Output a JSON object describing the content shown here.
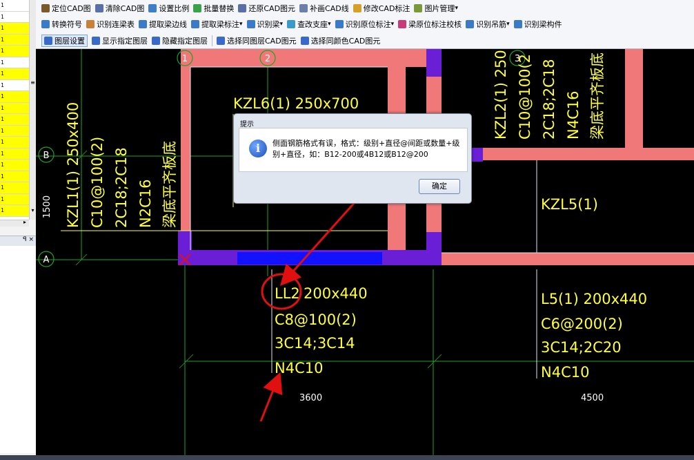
{
  "left_panel": {
    "rows": [
      {
        "text": "1",
        "highlight": false
      },
      {
        "text": "1",
        "highlight": false
      },
      {
        "text": "1",
        "highlight": true
      },
      {
        "text": "1",
        "highlight": true
      },
      {
        "text": "1",
        "highlight": true
      },
      {
        "text": "1",
        "highlight": false
      },
      {
        "text": "1",
        "highlight": true
      },
      {
        "text": "1",
        "highlight": false
      },
      {
        "text": "1",
        "highlight": true
      },
      {
        "text": "1",
        "highlight": true
      },
      {
        "text": "1",
        "highlight": true
      },
      {
        "text": "1",
        "highlight": true
      },
      {
        "text": "1",
        "highlight": true
      },
      {
        "text": "1",
        "highlight": true
      },
      {
        "text": "1",
        "highlight": true
      },
      {
        "text": "1",
        "highlight": true
      },
      {
        "text": "1",
        "highlight": true
      },
      {
        "text": "1",
        "highlight": true
      },
      {
        "text": "1",
        "highlight": true
      }
    ],
    "scroll_marker": "≡",
    "pane_controls": "ꟼ ×"
  },
  "toolbar": {
    "row1": [
      {
        "label": "定位CAD图",
        "icon": "locate-cad-icon",
        "color": "#7a5a2a"
      },
      {
        "label": "清除CAD图",
        "icon": "clear-cad-icon",
        "color": "#5a6ea8"
      },
      {
        "label": "设置比例",
        "icon": "set-scale-icon",
        "color": "#3f7fc9"
      },
      {
        "label": "批量替换",
        "icon": "batch-replace-icon",
        "color": "#3aa24a"
      },
      {
        "label": "还原CAD图元",
        "icon": "restore-cad-icon",
        "color": "#5a6ea8"
      },
      {
        "label": "补画CAD线",
        "icon": "draw-cad-line-icon",
        "color": "#6b7fa8"
      },
      {
        "label": "修改CAD标注",
        "icon": "edit-cad-label-icon",
        "color": "#d6a028"
      },
      {
        "label": "图片管理",
        "icon": "image-manage-icon",
        "color": "#7a9a3a",
        "dropdown": true
      }
    ],
    "row2": [
      {
        "label": "转换符号",
        "icon": "convert-symbol-icon",
        "color": "#3a7ac9"
      },
      {
        "label": "识别连梁表",
        "icon": "recognize-beam-table-icon",
        "color": "#c9813a"
      },
      {
        "label": "提取梁边线",
        "icon": "extract-beam-edge-icon",
        "color": "#3a7ac9"
      },
      {
        "label": "提取梁标注",
        "icon": "extract-beam-label-icon",
        "color": "#3a7ac9",
        "dropdown": true
      },
      {
        "label": "识别梁",
        "icon": "recognize-beam-icon",
        "color": "#3a7ac9",
        "dropdown": true
      },
      {
        "label": "查改支座",
        "icon": "check-support-icon",
        "color": "#3a9ac9",
        "dropdown": true
      },
      {
        "label": "识别原位标注",
        "icon": "recognize-inplace-label-icon",
        "color": "#3a7ac9",
        "dropdown": true
      },
      {
        "label": "梁原位标注校核",
        "icon": "beam-label-check-icon",
        "color": "#c93a7a"
      },
      {
        "label": "识别吊筋",
        "icon": "recognize-hanger-icon",
        "color": "#3a7ac9",
        "dropdown": true
      },
      {
        "label": "识别梁构件",
        "icon": "recognize-beam-member-icon",
        "color": "#3a7ac9"
      }
    ],
    "row3": [
      {
        "label": "图层设置",
        "icon": "layer-settings-icon",
        "color": "#3a6ac9",
        "active": true
      },
      {
        "label": "显示指定图层",
        "icon": "show-layer-icon",
        "color": "#3a6ac9"
      },
      {
        "label": "隐藏指定图层",
        "icon": "hide-layer-icon",
        "color": "#3a6ac9"
      },
      {
        "label": "选择同图层CAD图元",
        "icon": "select-same-layer-icon",
        "color": "#3a6ac9"
      },
      {
        "label": "选择同颜色CAD图元",
        "icon": "select-same-color-icon",
        "color": "#3a6ac9"
      }
    ],
    "dropdown_arrow": "▾"
  },
  "drawing": {
    "axis_labels": [
      "1",
      "2",
      "3",
      "B",
      "A"
    ],
    "dimension_1500": "1500",
    "dimension_3600": "3600",
    "dimension_4500": "4500",
    "beam_kzl1": [
      "KZL1(1) 250x400",
      "C10@100(2)",
      "2C18;2C18",
      "N2C16",
      "梁底平齐板底"
    ],
    "beam_kzl6": [
      "KZL6(1) 250x700"
    ],
    "beam_kzl2": [
      "KZL2(1) 250",
      "C10@100(2",
      "2C18;2C18",
      "N4C16",
      "梁底平齐板底"
    ],
    "beam_kzl5": [
      "KZL5(1)"
    ],
    "beam_ll2_prefix": "LL2",
    "beam_ll2": [
      " 200x440",
      "C8@100(2)",
      "3C14;3C14",
      "N4C10"
    ],
    "beam_l5": [
      "L5(1) 200x440",
      "C6@200(2)",
      "3C14;2C20",
      "N4C10"
    ],
    "colors": {
      "annotation": "#ffff3b",
      "beam_fill": "#f07878",
      "column": "#6a1fd6",
      "highlight_beam": "#1212ff",
      "grid_line": "#1fa31f",
      "marker_red": "#e01010"
    }
  },
  "dialog": {
    "title": "提示",
    "message": "侧面钢筋格式有误，格式：级别+直径@间距或数量+级别+直径，如：B12-200或4B12或B12@200",
    "ok_label": "确定",
    "info_glyph": "i"
  }
}
